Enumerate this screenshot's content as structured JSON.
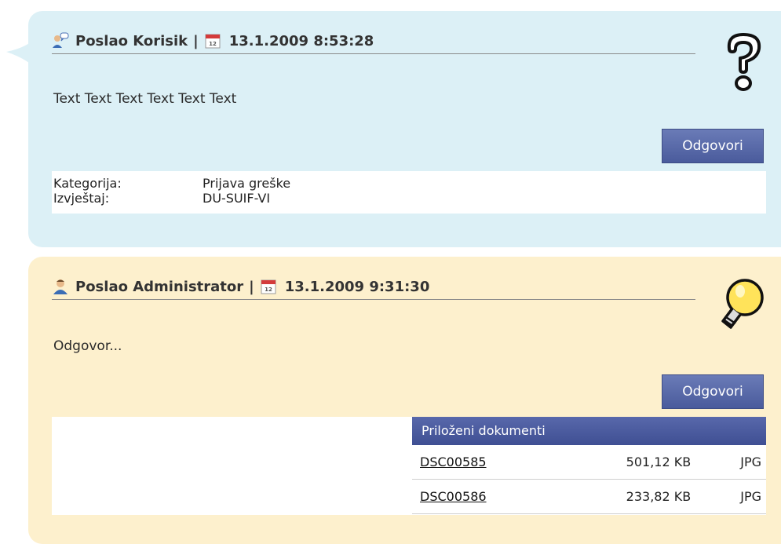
{
  "posts": [
    {
      "author": "Poslao Korisik",
      "separator": "|",
      "datetime": "13.1.2009 8:53:28",
      "message": "Text Text Text Text Text Text",
      "reply_label": "Odgovori",
      "meta": [
        {
          "key": "Kategorija:",
          "value": "Prijava greške"
        },
        {
          "key": "Izvještaj:",
          "value": "DU-SUIF-VI"
        }
      ],
      "user_icon": "user-speech-icon",
      "badge_icon": "question-mark-icon",
      "background": "#dcf0f6"
    },
    {
      "author": "Poslao Administrator",
      "separator": "|",
      "datetime": "13.1.2009 9:31:30",
      "message": "Odgovor...",
      "reply_label": "Odgovori",
      "attachments": {
        "header": "Priloženi dokumenti",
        "rows": [
          {
            "name": "DSC00585",
            "size": "501,12 KB",
            "type": "JPG"
          },
          {
            "name": "DSC00586",
            "size": "233,82 KB",
            "type": "JPG"
          }
        ]
      },
      "user_icon": "admin-user-icon",
      "badge_icon": "lightbulb-icon",
      "background": "#fdf0cd"
    }
  ],
  "colors": {
    "button": "#5567a8",
    "table_header": "#4a5a9e"
  }
}
